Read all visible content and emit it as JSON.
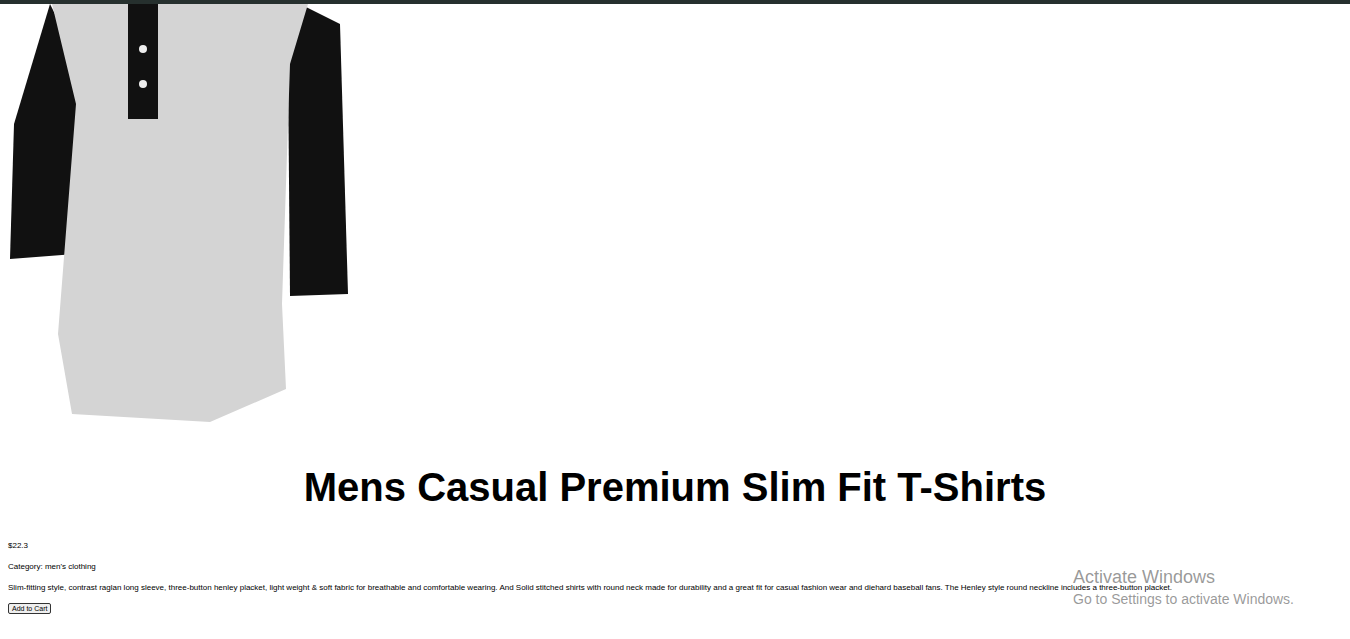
{
  "product": {
    "title": "Mens Casual Premium Slim Fit T-Shirts",
    "price": "$22.3",
    "category": "Category: men's clothing",
    "description": "Slim-fitting style, contrast raglan long sleeve, three-button henley placket, light weight & soft fabric for breathable and comfortable wearing. And Solid stitched shirts with round neck made for durability and a great fit for casual fashion wear and diehard baseball fans. The Henley style round neckline includes a three-button placket.",
    "button": "Add to Cart"
  },
  "watermark": {
    "title": "Activate Windows",
    "subtitle": "Go to Settings to activate Windows."
  }
}
